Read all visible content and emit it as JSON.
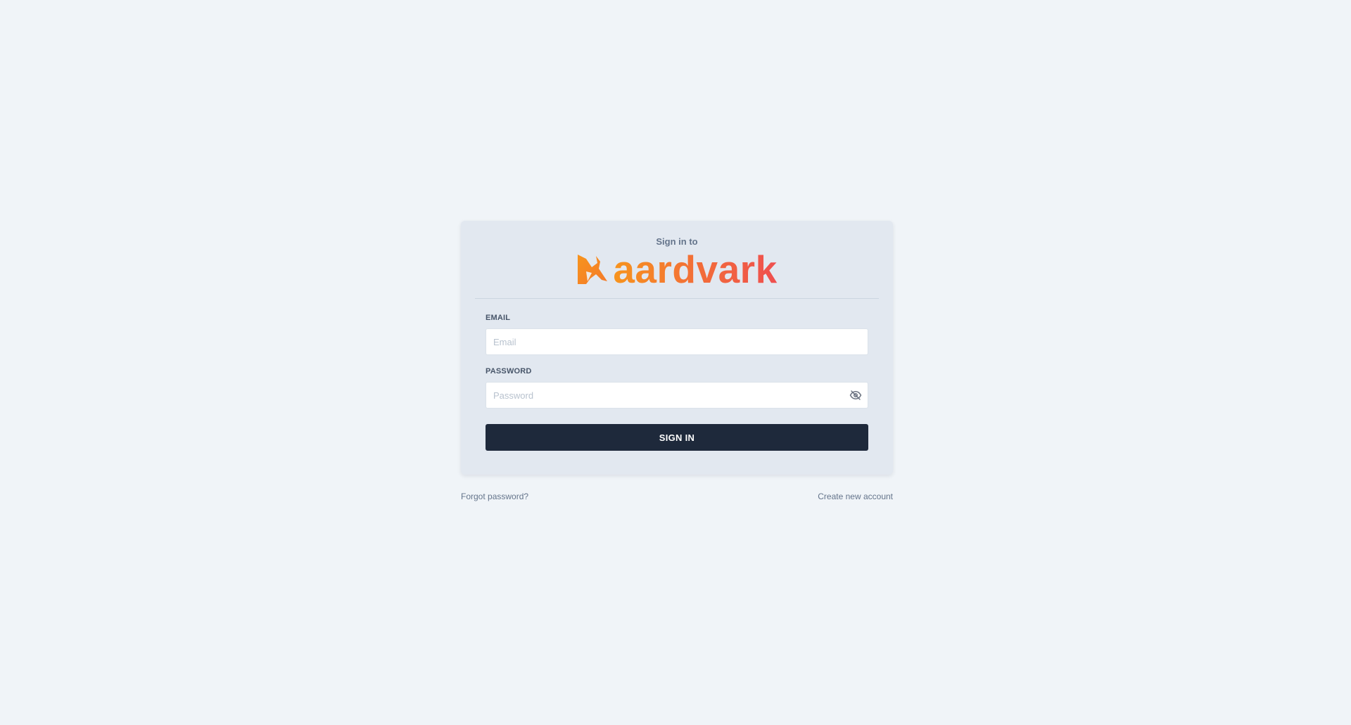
{
  "header": {
    "subtitle": "Sign in to",
    "brand_name": "aardvark",
    "brand_icon": "aardvark-logo-icon"
  },
  "form": {
    "email": {
      "label": "EMAIL",
      "placeholder": "Email",
      "value": ""
    },
    "password": {
      "label": "PASSWORD",
      "placeholder": "Password",
      "value": "",
      "toggle_icon": "eye-slash-icon"
    },
    "submit_label": "SIGN IN"
  },
  "footer": {
    "forgot_password": "Forgot password?",
    "create_account": "Create new account"
  },
  "colors": {
    "background": "#f0f4f8",
    "card": "#e2e8f0",
    "button": "#1e293b",
    "brand_start": "#f7941d",
    "brand_end": "#ef4f4f"
  }
}
